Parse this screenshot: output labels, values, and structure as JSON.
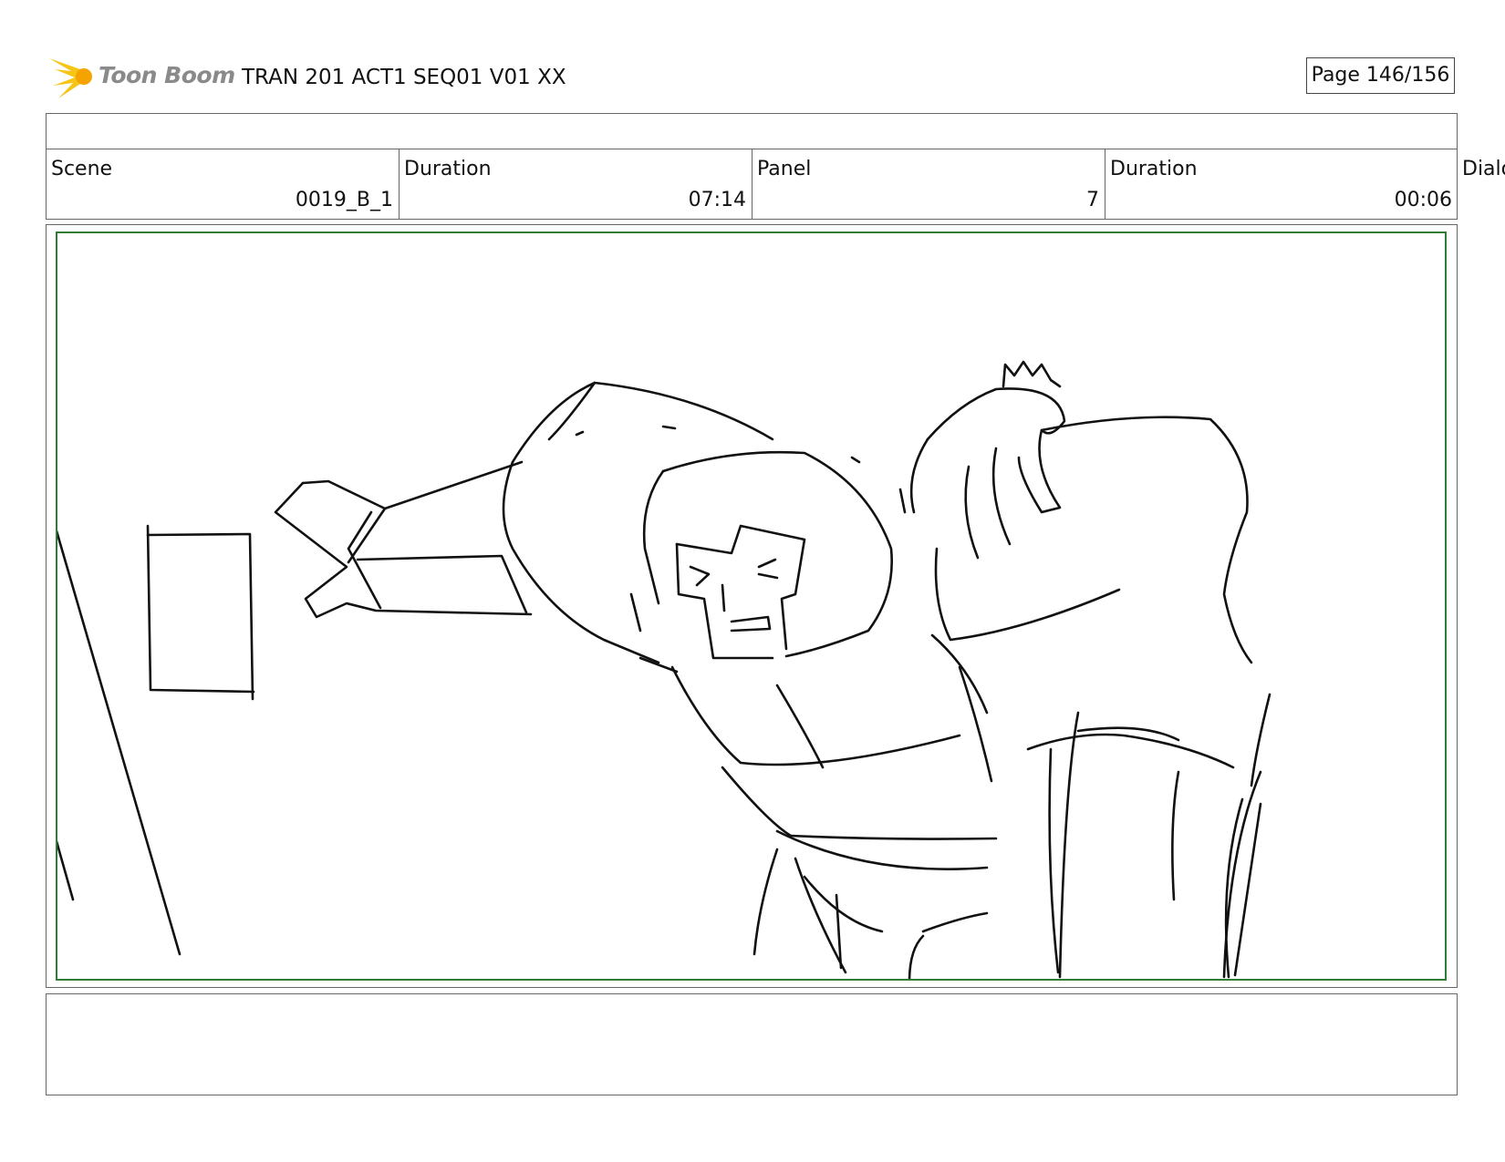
{
  "header": {
    "logo_text": "Toon Boom",
    "title": "TRAN 201 ACT1 SEQ01 V01 XX",
    "page": "Page 146/156"
  },
  "info": {
    "scene_label": "Scene",
    "scene_value": "0019_B_1",
    "duration_label": "Duration",
    "duration_value": "07:14",
    "panel_label": "Panel",
    "panel_value": "7",
    "panel_duration_label": "Duration",
    "panel_duration_value": "00:06",
    "dialog_label": "Dialo"
  },
  "colors": {
    "logo_accent": "#f5c518",
    "panel_border": "#2e7d32"
  },
  "panel_image": {
    "icon": "storyboard-sketch"
  },
  "notes": {
    "text": ""
  }
}
